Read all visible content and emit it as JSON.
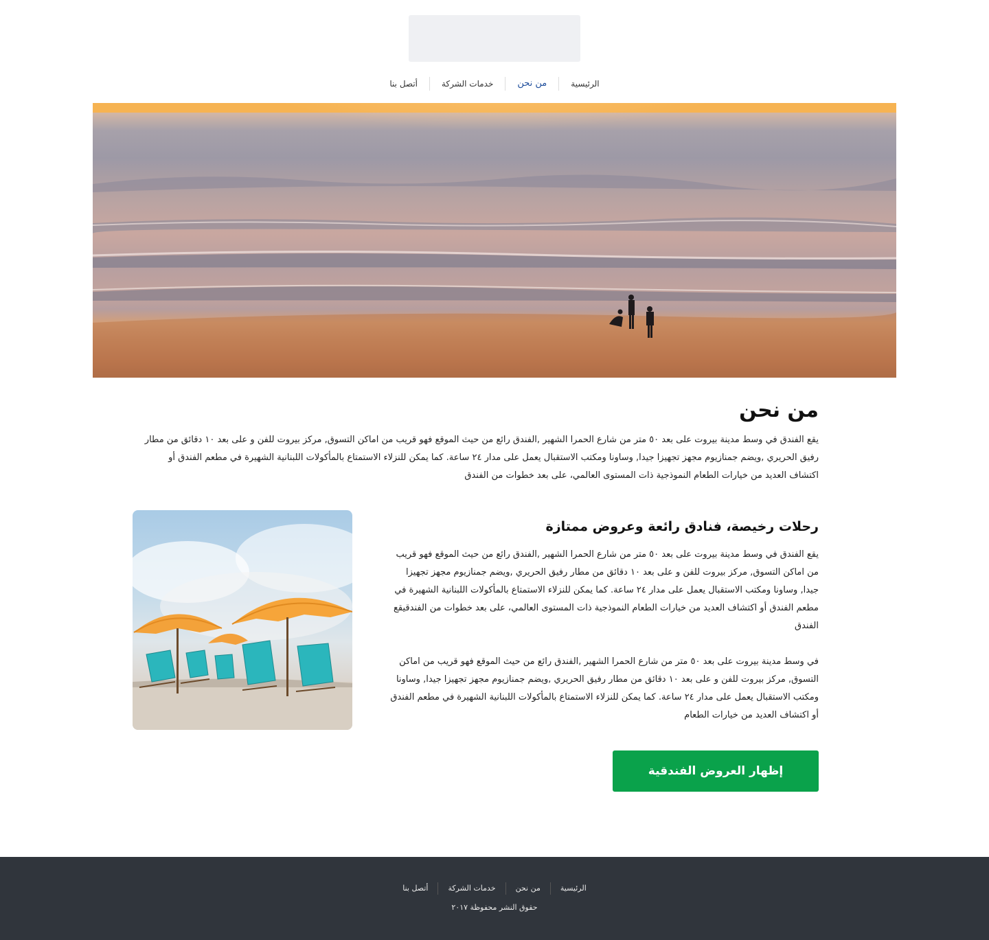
{
  "header": {
    "nav": [
      {
        "label": "الرئيسية",
        "active": false
      },
      {
        "label": "من نحن",
        "active": true
      },
      {
        "label": "خدمات الشركة",
        "active": false
      },
      {
        "label": "أتصل بنا",
        "active": false
      }
    ]
  },
  "main": {
    "title": "من نحن",
    "intro": "يقع الفندق  في وسط مدينة بيروت على بعد ٥٠ متر من شارع الحمرا الشهير ,الفندق رائع من حيث الموقع فهو قريب من اماكن التسوق, مركز بيروت للفن و على بعد ١٠ دقائق من مطار رفيق الحريري  ,ويضم جمنازيوم مجهز تجهيزا جيدا, وساونا ومكتب الاستقبال يعمل على مدار ٢٤ ساعة.  كما يمكن للنزلاء الاستمتاع بالمأكولات اللبنانية الشهيرة في مطعم الفندق أو اكتشاف العديد من خيارات الطعام النموذجية ذات المستوى العالمي، على بعد خطوات من الفندق",
    "section_title": "رحلات رخيصة، فنادق رائعة وعروض ممتازة",
    "paragraph1": "يقع الفندق  في وسط مدينة بيروت على بعد ٥٠ متر من شارع الحمرا الشهير ,الفندق رائع من حيث الموقع فهو قريب من اماكن التسوق, مركز بيروت للفن و على بعد ١٠ دقائق من مطار رفيق الحريري  ,ويضم جمنازيوم مجهز تجهيزا جيدا, وساونا ومكتب الاستقبال يعمل على مدار ٢٤ ساعة.  كما يمكن للنزلاء الاستمتاع بالمأكولات اللبنانية الشهيرة في مطعم الفندق أو اكتشاف العديد من خيارات الطعام النموذجية ذات المستوى العالمي، على بعد خطوات من الفندقيقع الفندق",
    "paragraph2": "في وسط مدينة بيروت على بعد ٥٠ متر من شارع الحمرا الشهير ,الفندق رائع من حيث الموقع فهو قريب من اماكن التسوق, مركز بيروت للفن و على بعد ١٠ دقائق من مطار رفيق الحريري  ,ويضم جمنازيوم مجهز تجهيزا جيدا, وساونا ومكتب الاستقبال يعمل على مدار ٢٤ ساعة. كما يمكن للنزلاء الاستمتاع بالمأكولات اللبنانية الشهيرة في مطعم الفندق أو اكتشاف العديد من خيارات الطعام",
    "cta_label": "إظهار العروض الفندقية"
  },
  "footer": {
    "nav": [
      {
        "label": "الرئيسية"
      },
      {
        "label": "من نحن"
      },
      {
        "label": "خدمات الشركة"
      },
      {
        "label": "أتصل بنا"
      }
    ],
    "copyright": "حقوق النشر محفوظة ٢٠١٧"
  },
  "colors": {
    "accent_nav": "#1f4e9c",
    "cta": "#0aa24b",
    "footer_bg": "#30353c"
  }
}
